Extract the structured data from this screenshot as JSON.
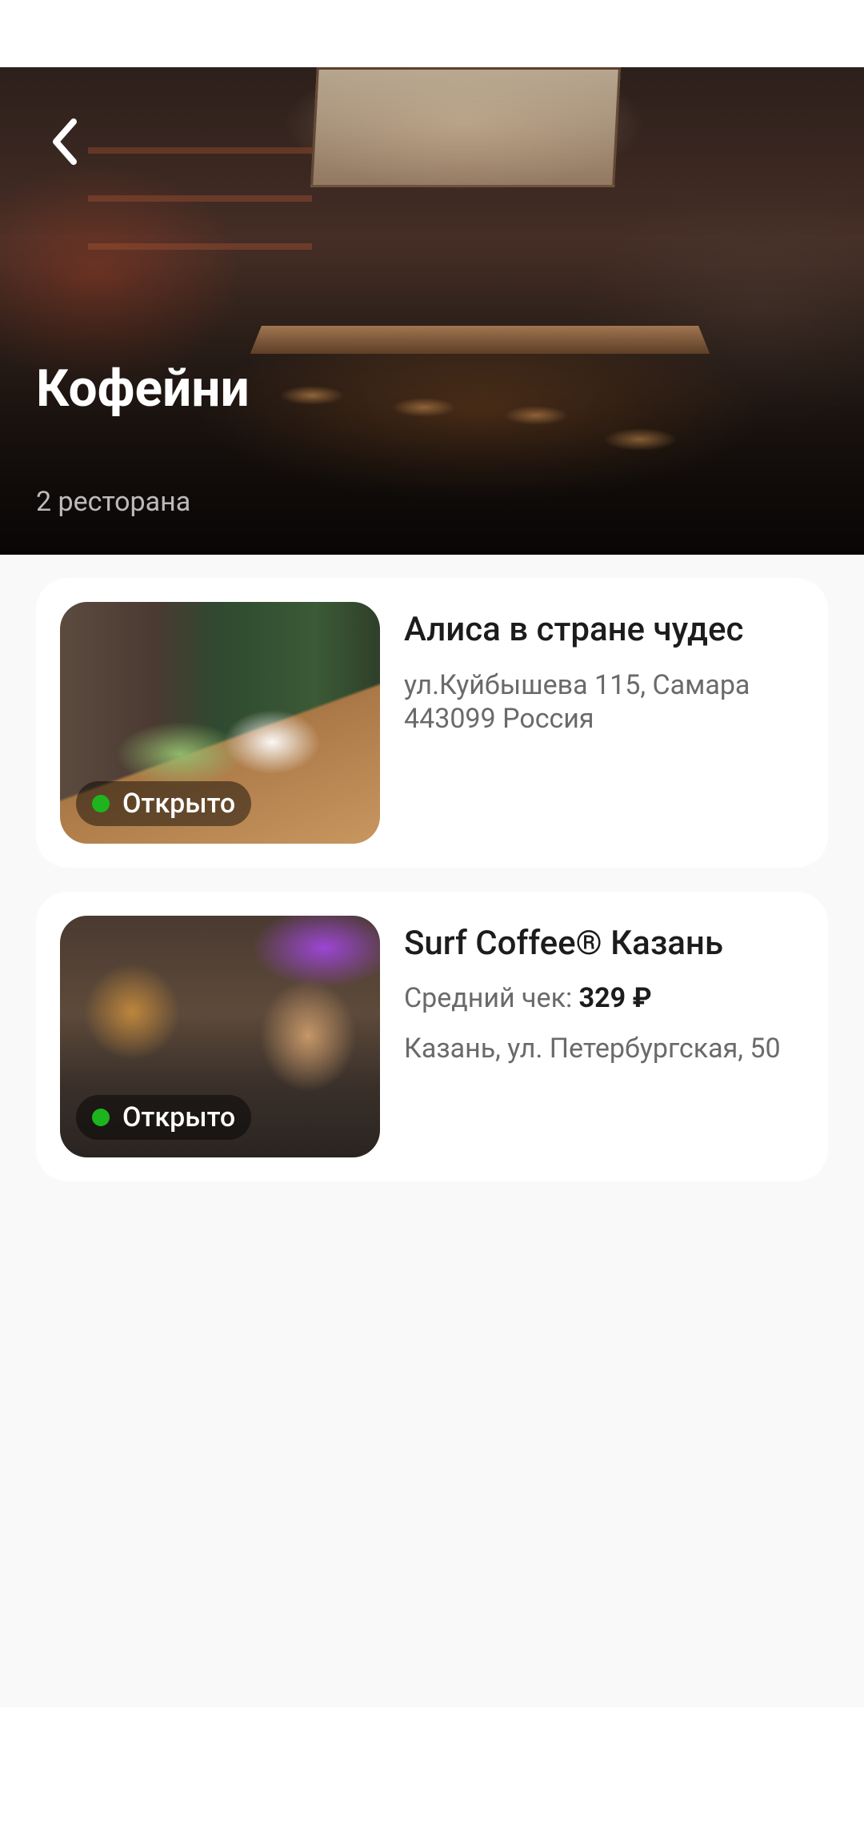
{
  "header": {
    "title": "Кофейни",
    "subtitle": "2 ресторана",
    "back_icon": "chevron-left-icon"
  },
  "restaurants": [
    {
      "name": "Алиса в стране чудес",
      "address": "ул.Куйбышева 115, Самара 443099 Россия",
      "status": "Открыто",
      "status_color": "#1db41d"
    },
    {
      "name": "Surf Coffee® Казань",
      "avg_check_label": "Средний чек:",
      "avg_check_value": "329 ₽",
      "address": "Казань, ул. Петербургская, 50",
      "status": "Открыто",
      "status_color": "#1db41d"
    }
  ],
  "colors": {
    "background": "#f9f9f9",
    "card": "#ffffff",
    "title_text": "#1c1c1c",
    "secondary_text": "#6a6a6a",
    "open_indicator": "#1db41d"
  }
}
